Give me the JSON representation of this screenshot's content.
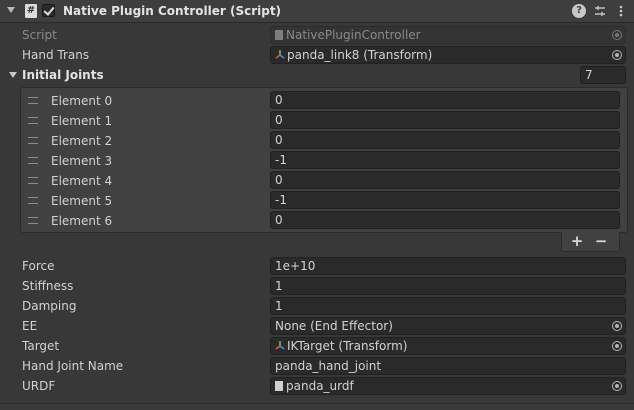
{
  "header": {
    "title": "Native Plugin Controller (Script)",
    "icons": [
      "foldout-arrow-icon",
      "script-icon",
      "enabled-checkbox",
      "help-icon",
      "presets-icon",
      "menu-icon"
    ]
  },
  "fields": {
    "script": {
      "label": "Script",
      "value": "NativePluginController"
    },
    "hand_trans": {
      "label": "Hand Trans",
      "value": "panda_link8 (Transform)"
    }
  },
  "initial_joints": {
    "label": "Initial Joints",
    "size": "7",
    "elements": [
      {
        "label": "Element 0",
        "value": "0"
      },
      {
        "label": "Element 1",
        "value": "0"
      },
      {
        "label": "Element 2",
        "value": "0"
      },
      {
        "label": "Element 3",
        "value": "-1"
      },
      {
        "label": "Element 4",
        "value": "0"
      },
      {
        "label": "Element 5",
        "value": "-1"
      },
      {
        "label": "Element 6",
        "value": "0"
      }
    ],
    "add_label": "+",
    "remove_label": "−"
  },
  "properties": {
    "force": {
      "label": "Force",
      "value": "1e+10"
    },
    "stiffness": {
      "label": "Stiffness",
      "value": "1"
    },
    "damping": {
      "label": "Damping",
      "value": "1"
    },
    "ee": {
      "label": "EE",
      "value": "None (End Effector)"
    },
    "target": {
      "label": "Target",
      "value": "IKTarget (Transform)"
    },
    "hand_joint_name": {
      "label": "Hand Joint Name",
      "value": "panda_hand_joint"
    },
    "urdf": {
      "label": "URDF",
      "value": "panda_urdf"
    }
  }
}
